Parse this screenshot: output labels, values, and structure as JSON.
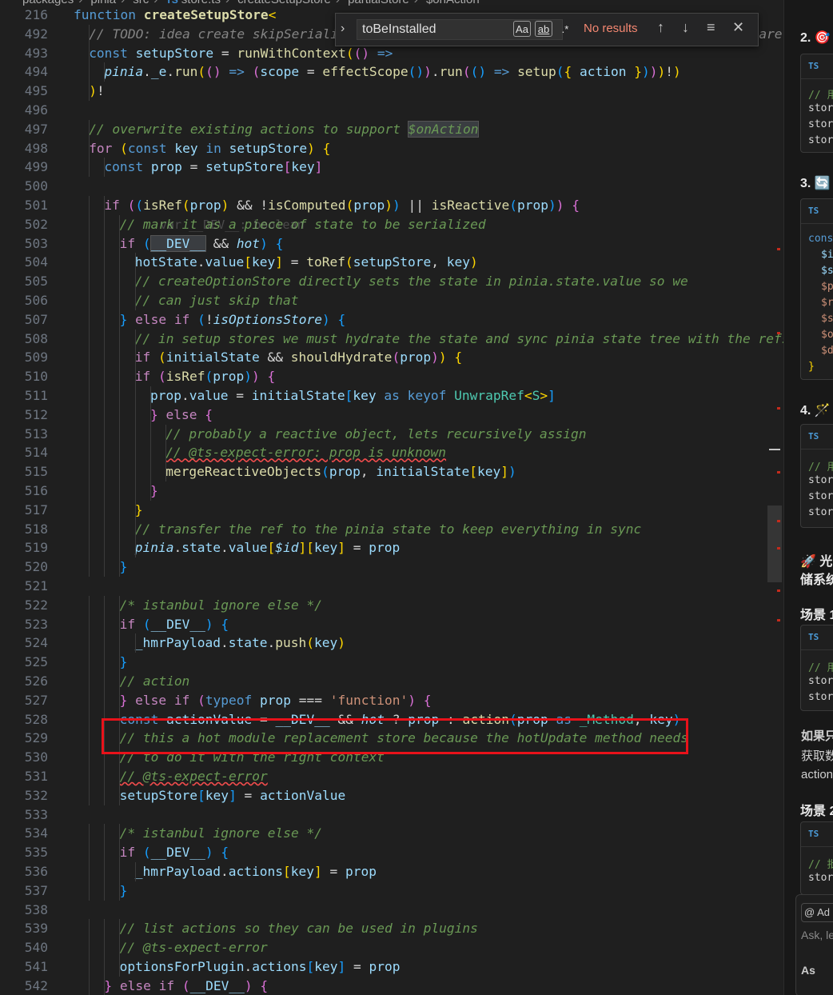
{
  "breadcrumb": {
    "items": [
      "packages",
      "pinia",
      "src",
      "store.ts",
      "createSetupStore",
      "partialStore",
      "$onAction"
    ],
    "ts_badge": "TS"
  },
  "find": {
    "query": "toBeInstalled",
    "match_case": "Aa",
    "whole_word": "ab",
    "regex": ".*",
    "results": "No results",
    "prev_icon": "↑",
    "next_icon": "↓",
    "selection_icon": "≡",
    "close_icon": "✕",
    "toggle_icon": "›"
  },
  "hover_hint": "var __DEV__: boolean",
  "lines": [
    {
      "n": "216",
      "t": [
        [
          "kw",
          "function "
        ],
        [
          "fnbold",
          "createSetupStore"
        ],
        [
          "b1",
          "<"
        ]
      ]
    },
    {
      "n": "492",
      "t": [
        [
          "cg",
          "// TODO: idea create skipSerialize that marks properties as non serializable and they are"
        ]
      ]
    },
    {
      "n": "493",
      "t": [
        [
          "kw",
          "const "
        ],
        [
          "var",
          "setupStore"
        ],
        [
          "plain",
          " = "
        ],
        [
          "fn",
          "runWithContext"
        ],
        [
          "b1",
          "("
        ],
        [
          "b2",
          "("
        ],
        [
          "b2",
          ")"
        ],
        [
          "plain",
          " "
        ],
        [
          "kw",
          "=>"
        ]
      ]
    },
    {
      "n": "494",
      "t": [
        [
          "var it",
          "pinia"
        ],
        [
          "plain",
          "."
        ],
        [
          "var",
          "_e"
        ],
        [
          "plain",
          "."
        ],
        [
          "fn",
          "run"
        ],
        [
          "b1",
          "("
        ],
        [
          "b2",
          "("
        ],
        [
          "b2",
          ")"
        ],
        [
          "plain",
          " "
        ],
        [
          "kw",
          "=>"
        ],
        [
          "plain",
          " "
        ],
        [
          "b2",
          "("
        ],
        [
          "var",
          "scope"
        ],
        [
          "plain",
          " = "
        ],
        [
          "fn",
          "effectScope"
        ],
        [
          "b3",
          "("
        ],
        [
          "b3",
          ")"
        ],
        [
          "b2",
          ")"
        ],
        [
          "plain",
          "."
        ],
        [
          "fn",
          "run"
        ],
        [
          "b2",
          "("
        ],
        [
          "b3",
          "("
        ],
        [
          "b3",
          ")"
        ],
        [
          "plain",
          " "
        ],
        [
          "kw",
          "=>"
        ],
        [
          "plain",
          " "
        ],
        [
          "fn",
          "setup"
        ],
        [
          "b3",
          "("
        ],
        [
          "b1",
          "{ "
        ],
        [
          "var",
          "action"
        ],
        [
          "b1",
          " }"
        ],
        [
          "b3",
          ")"
        ],
        [
          "b2",
          ")"
        ],
        [
          "b1",
          ")"
        ],
        [
          "plain",
          "!"
        ],
        [
          "b1",
          ")"
        ]
      ]
    },
    {
      "n": "495",
      "t": [
        [
          "b1",
          ")"
        ],
        [
          "plain",
          "!"
        ]
      ]
    },
    {
      "n": "496",
      "t": []
    },
    {
      "n": "497",
      "t": [
        [
          "cm",
          "// overwrite existing actions to support "
        ],
        [
          "cm hlbox",
          "$onAction"
        ]
      ]
    },
    {
      "n": "498",
      "t": [
        [
          "ctl",
          "for "
        ],
        [
          "b1",
          "("
        ],
        [
          "kw",
          "const "
        ],
        [
          "var",
          "key"
        ],
        [
          "kw",
          " in "
        ],
        [
          "var",
          "setupStore"
        ],
        [
          "b1",
          ")"
        ],
        [
          "plain",
          " "
        ],
        [
          "b1",
          "{"
        ]
      ]
    },
    {
      "n": "499",
      "t": [
        [
          "kw",
          "const "
        ],
        [
          "var",
          "prop"
        ],
        [
          "plain",
          " = "
        ],
        [
          "var",
          "setupStore"
        ],
        [
          "b2",
          "["
        ],
        [
          "var",
          "key"
        ],
        [
          "b2",
          "]"
        ]
      ]
    },
    {
      "n": "500",
      "t": []
    },
    {
      "n": "501",
      "t": [
        [
          "ctl",
          "if "
        ],
        [
          "b2",
          "("
        ],
        [
          "b3",
          "("
        ],
        [
          "fn",
          "isRef"
        ],
        [
          "b1",
          "("
        ],
        [
          "var",
          "prop"
        ],
        [
          "b1",
          ")"
        ],
        [
          "plain",
          " && !"
        ],
        [
          "fn",
          "isComputed"
        ],
        [
          "b1",
          "("
        ],
        [
          "var",
          "prop"
        ],
        [
          "b1",
          ")"
        ],
        [
          "b3",
          ")"
        ],
        [
          "plain",
          " || "
        ],
        [
          "fn",
          "isReactive"
        ],
        [
          "b3",
          "("
        ],
        [
          "var",
          "prop"
        ],
        [
          "b3",
          ")"
        ],
        [
          "b2",
          ")"
        ],
        [
          "plain",
          " "
        ],
        [
          "b2",
          "{"
        ]
      ]
    },
    {
      "n": "502",
      "t": [
        [
          "cm",
          "// mark it as a piece of state to be serialized"
        ]
      ]
    },
    {
      "n": "503",
      "t": [
        [
          "ctl",
          "if "
        ],
        [
          "b3",
          "("
        ],
        [
          "var hlbox",
          "__DEV__"
        ],
        [
          "plain",
          " && "
        ],
        [
          "var it",
          "hot"
        ],
        [
          "b3",
          ")"
        ],
        [
          "plain",
          " "
        ],
        [
          "b3",
          "{"
        ]
      ]
    },
    {
      "n": "504",
      "t": [
        [
          "var",
          "hotState"
        ],
        [
          "plain",
          "."
        ],
        [
          "var",
          "value"
        ],
        [
          "b1",
          "["
        ],
        [
          "var",
          "key"
        ],
        [
          "b1",
          "]"
        ],
        [
          "plain",
          " = "
        ],
        [
          "fn",
          "toRef"
        ],
        [
          "b1",
          "("
        ],
        [
          "var",
          "setupStore"
        ],
        [
          "plain",
          ", "
        ],
        [
          "var",
          "key"
        ],
        [
          "b1",
          ")"
        ]
      ]
    },
    {
      "n": "505",
      "t": [
        [
          "cm",
          "// createOptionStore directly sets the state in pinia.state.value so we"
        ]
      ]
    },
    {
      "n": "506",
      "t": [
        [
          "cm",
          "// can just skip that"
        ]
      ]
    },
    {
      "n": "507",
      "t": [
        [
          "b3",
          "}"
        ],
        [
          "ctl",
          " else if "
        ],
        [
          "b3",
          "("
        ],
        [
          "plain",
          "!"
        ],
        [
          "var it",
          "isOptionsStore"
        ],
        [
          "b3",
          ")"
        ],
        [
          "plain",
          " "
        ],
        [
          "b3",
          "{"
        ]
      ]
    },
    {
      "n": "508",
      "t": [
        [
          "cm",
          "// in setup stores we must hydrate the state and sync pinia state tree with the refs"
        ]
      ]
    },
    {
      "n": "509",
      "t": [
        [
          "ctl",
          "if "
        ],
        [
          "b1",
          "("
        ],
        [
          "var",
          "initialState"
        ],
        [
          "plain",
          " && "
        ],
        [
          "fn",
          "shouldHydrate"
        ],
        [
          "b2",
          "("
        ],
        [
          "var",
          "prop"
        ],
        [
          "b2",
          ")"
        ],
        [
          "b1",
          ")"
        ],
        [
          "plain",
          " "
        ],
        [
          "b1",
          "{"
        ]
      ]
    },
    {
      "n": "510",
      "t": [
        [
          "ctl",
          "if "
        ],
        [
          "b2",
          "("
        ],
        [
          "fn",
          "isRef"
        ],
        [
          "b3",
          "("
        ],
        [
          "var",
          "prop"
        ],
        [
          "b3",
          ")"
        ],
        [
          "b2",
          ")"
        ],
        [
          "plain",
          " "
        ],
        [
          "b2",
          "{"
        ]
      ]
    },
    {
      "n": "511",
      "t": [
        [
          "var",
          "prop"
        ],
        [
          "plain",
          "."
        ],
        [
          "var",
          "value"
        ],
        [
          "plain",
          " = "
        ],
        [
          "var",
          "initialState"
        ],
        [
          "b3",
          "["
        ],
        [
          "var",
          "key"
        ],
        [
          "kw",
          " as keyof "
        ],
        [
          "typ",
          "UnwrapRef"
        ],
        [
          "b1",
          "<"
        ],
        [
          "typ",
          "S"
        ],
        [
          "b1",
          ">"
        ],
        [
          "b3",
          "]"
        ]
      ]
    },
    {
      "n": "512",
      "t": [
        [
          "b2",
          "}"
        ],
        [
          "ctl",
          " else "
        ],
        [
          "b2",
          "{"
        ]
      ]
    },
    {
      "n": "513",
      "t": [
        [
          "cm",
          "// probably a reactive object, lets recursively assign"
        ]
      ]
    },
    {
      "n": "514",
      "t": [
        [
          "cm squig",
          "// @ts-expect-error: prop is unknown"
        ]
      ]
    },
    {
      "n": "515",
      "t": [
        [
          "fn",
          "mergeReactiveObjects"
        ],
        [
          "b3",
          "("
        ],
        [
          "var",
          "prop"
        ],
        [
          "plain",
          ", "
        ],
        [
          "var",
          "initialState"
        ],
        [
          "b1",
          "["
        ],
        [
          "var",
          "key"
        ],
        [
          "b1",
          "]"
        ],
        [
          "b3",
          ")"
        ]
      ]
    },
    {
      "n": "516",
      "t": [
        [
          "b2",
          "}"
        ]
      ]
    },
    {
      "n": "517",
      "t": [
        [
          "b1",
          "}"
        ]
      ]
    },
    {
      "n": "518",
      "t": [
        [
          "cm",
          "// transfer the ref to the pinia state to keep everything in sync"
        ]
      ]
    },
    {
      "n": "519",
      "t": [
        [
          "var it",
          "pinia"
        ],
        [
          "plain",
          "."
        ],
        [
          "var",
          "state"
        ],
        [
          "plain",
          "."
        ],
        [
          "var",
          "value"
        ],
        [
          "b1",
          "["
        ],
        [
          "var it",
          "$id"
        ],
        [
          "b1",
          "]"
        ],
        [
          "b1",
          "["
        ],
        [
          "var",
          "key"
        ],
        [
          "b1",
          "]"
        ],
        [
          "plain",
          " = "
        ],
        [
          "var",
          "prop"
        ]
      ]
    },
    {
      "n": "520",
      "t": [
        [
          "b3",
          "}"
        ]
      ]
    },
    {
      "n": "521",
      "t": []
    },
    {
      "n": "522",
      "t": [
        [
          "cm",
          "/* istanbul ignore else */"
        ]
      ]
    },
    {
      "n": "523",
      "t": [
        [
          "ctl",
          "if "
        ],
        [
          "b3",
          "("
        ],
        [
          "var",
          "__DEV__"
        ],
        [
          "b3",
          ")"
        ],
        [
          "plain",
          " "
        ],
        [
          "b3",
          "{"
        ]
      ]
    },
    {
      "n": "524",
      "t": [
        [
          "var",
          "_hmrPayload"
        ],
        [
          "plain",
          "."
        ],
        [
          "var",
          "state"
        ],
        [
          "plain",
          "."
        ],
        [
          "fn",
          "push"
        ],
        [
          "b1",
          "("
        ],
        [
          "var",
          "key"
        ],
        [
          "b1",
          ")"
        ]
      ]
    },
    {
      "n": "525",
      "t": [
        [
          "b3",
          "}"
        ]
      ]
    },
    {
      "n": "526",
      "t": [
        [
          "cm",
          "// action"
        ]
      ]
    },
    {
      "n": "527",
      "t": [
        [
          "b2",
          "}"
        ],
        [
          "ctl",
          " else if "
        ],
        [
          "b2",
          "("
        ],
        [
          "kw",
          "typeof "
        ],
        [
          "var",
          "prop"
        ],
        [
          "plain",
          " === "
        ],
        [
          "str",
          "'function'"
        ],
        [
          "b2",
          ")"
        ],
        [
          "plain",
          " "
        ],
        [
          "b2",
          "{"
        ]
      ]
    },
    {
      "n": "528",
      "t": [
        [
          "kw",
          "const "
        ],
        [
          "var",
          "actionValue"
        ],
        [
          "plain",
          " = "
        ],
        [
          "var",
          "__DEV__"
        ],
        [
          "plain",
          " && "
        ],
        [
          "var it",
          "hot"
        ],
        [
          "plain",
          " ? "
        ],
        [
          "var",
          "prop"
        ],
        [
          "plain",
          " : "
        ],
        [
          "fn",
          "action"
        ],
        [
          "b3",
          "("
        ],
        [
          "var",
          "prop"
        ],
        [
          "kw",
          " as "
        ],
        [
          "typ",
          "_Method"
        ],
        [
          "plain",
          ", "
        ],
        [
          "var",
          "key"
        ],
        [
          "b3",
          ")"
        ]
      ]
    },
    {
      "n": "529",
      "t": [
        [
          "cm",
          "// this a hot module replacement store because the hotUpdate method needs"
        ]
      ]
    },
    {
      "n": "530",
      "t": [
        [
          "cm",
          "// to do it with the right context"
        ]
      ]
    },
    {
      "n": "531",
      "t": [
        [
          "cm squig",
          "// @ts-expect-error"
        ]
      ]
    },
    {
      "n": "532",
      "t": [
        [
          "var",
          "setupStore"
        ],
        [
          "b3",
          "["
        ],
        [
          "var",
          "key"
        ],
        [
          "b3",
          "]"
        ],
        [
          "plain",
          " = "
        ],
        [
          "var",
          "actionValue"
        ]
      ]
    },
    {
      "n": "533",
      "t": []
    },
    {
      "n": "534",
      "t": [
        [
          "cm",
          "/* istanbul ignore else */"
        ]
      ]
    },
    {
      "n": "535",
      "t": [
        [
          "ctl",
          "if "
        ],
        [
          "b3",
          "("
        ],
        [
          "var",
          "__DEV__"
        ],
        [
          "b3",
          ")"
        ],
        [
          "plain",
          " "
        ],
        [
          "b3",
          "{"
        ]
      ]
    },
    {
      "n": "536",
      "t": [
        [
          "var",
          "_hmrPayload"
        ],
        [
          "plain",
          "."
        ],
        [
          "var",
          "actions"
        ],
        [
          "b1",
          "["
        ],
        [
          "var",
          "key"
        ],
        [
          "b1",
          "]"
        ],
        [
          "plain",
          " = "
        ],
        [
          "var",
          "prop"
        ]
      ]
    },
    {
      "n": "537",
      "t": [
        [
          "b3",
          "}"
        ]
      ]
    },
    {
      "n": "538",
      "t": []
    },
    {
      "n": "539",
      "t": [
        [
          "cm",
          "// list actions so they can be used in plugins"
        ]
      ]
    },
    {
      "n": "540",
      "t": [
        [
          "cm",
          "// @ts-expect-error"
        ]
      ]
    },
    {
      "n": "541",
      "t": [
        [
          "var",
          "optionsForPlugin"
        ],
        [
          "plain",
          "."
        ],
        [
          "var",
          "actions"
        ],
        [
          "b3",
          "["
        ],
        [
          "var",
          "key"
        ],
        [
          "b3",
          "]"
        ],
        [
          "plain",
          " = "
        ],
        [
          "var",
          "prop"
        ]
      ]
    },
    {
      "n": "542",
      "t": [
        [
          "b2",
          "}"
        ],
        [
          "ctl",
          " else if "
        ],
        [
          "b2",
          "("
        ],
        [
          "var",
          "__DEV__"
        ],
        [
          "b2",
          ")"
        ],
        [
          "plain",
          " "
        ],
        [
          "b2",
          "{"
        ]
      ]
    }
  ],
  "sidebar": {
    "headings": [
      "2. 🎯",
      "3. 🔄",
      "4. 🪄",
      "🚀 光",
      "储系统",
      "场景 1",
      "如果只",
      "获取数",
      "action",
      "场景 2"
    ],
    "ts": "TS",
    "cards": {
      "c1": [
        "// 用",
        "stor",
        "stor",
        "stor"
      ],
      "c2": [
        "cons",
        "$i",
        "$s",
        "$p",
        "$r",
        "$s",
        "$o",
        "$d",
        "}"
      ],
      "c3": [
        "// 用",
        "stor",
        "stor",
        "stor"
      ],
      "c4": [
        "// 用",
        "stor",
        "stor"
      ],
      "c5": [
        "// 批",
        "stor"
      ]
    },
    "chat": {
      "add_label": "@ Ad",
      "placeholder": "Ask, le",
      "ask_label": "As"
    }
  }
}
